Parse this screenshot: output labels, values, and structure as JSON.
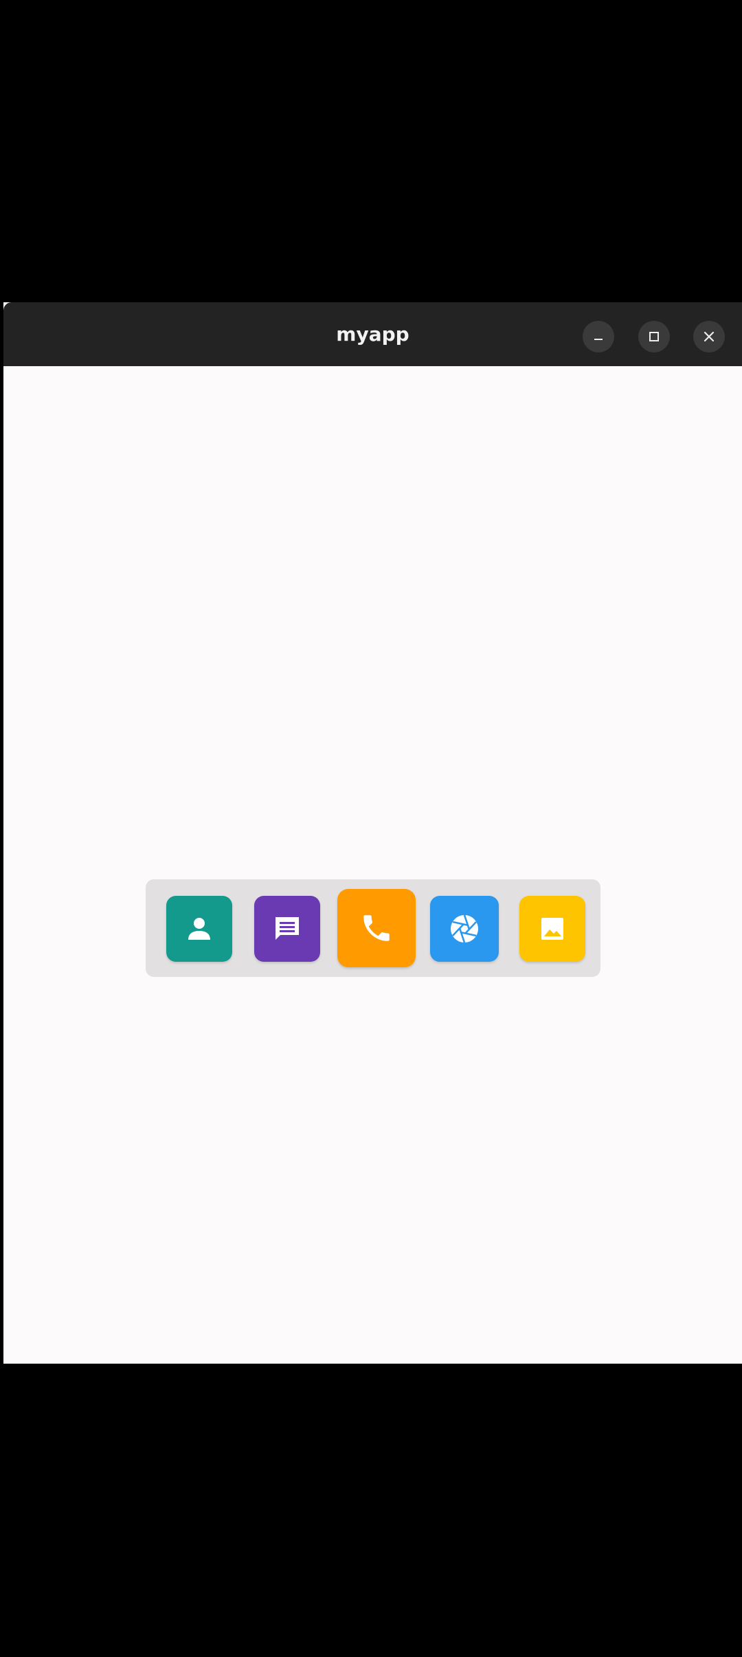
{
  "window": {
    "title": "myapp",
    "controls": [
      "minimize",
      "maximize",
      "close"
    ]
  },
  "dock": {
    "apps": [
      {
        "name": "contacts",
        "icon": "person-icon",
        "color": "#149a8c"
      },
      {
        "name": "messages",
        "icon": "message-icon",
        "color": "#6a3ab2"
      },
      {
        "name": "phone",
        "icon": "phone-icon",
        "color": "#ff9a00"
      },
      {
        "name": "camera",
        "icon": "aperture-icon",
        "color": "#2a98ee"
      },
      {
        "name": "gallery",
        "icon": "image-icon",
        "color": "#ffc400"
      }
    ]
  },
  "colors": {
    "titlebar": "#232323",
    "window_bg": "#fcfafb",
    "dock_bg": "#e2e0e1"
  }
}
